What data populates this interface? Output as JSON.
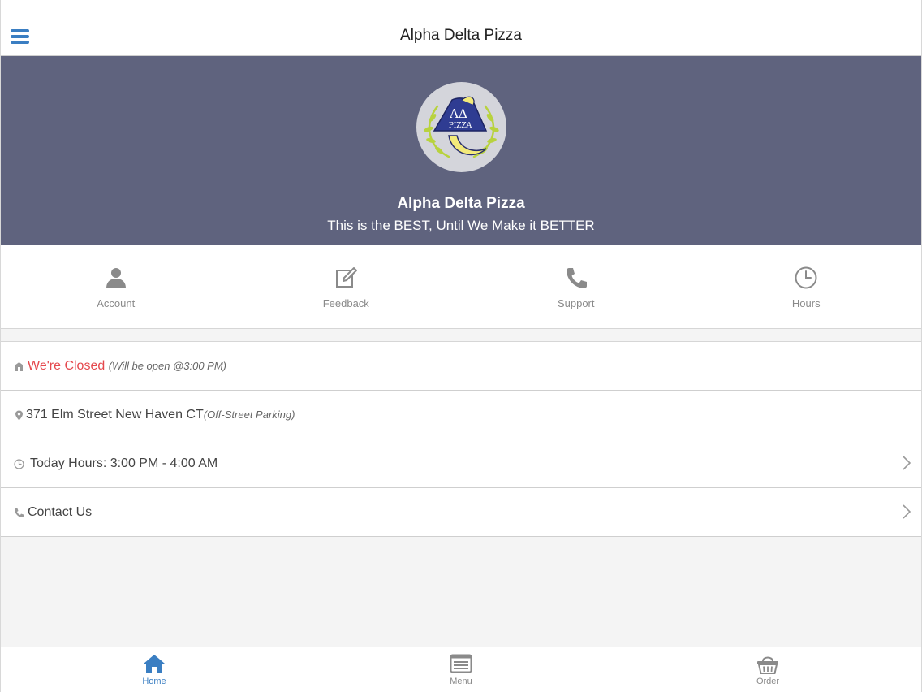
{
  "header": {
    "title": "Alpha Delta Pizza",
    "menu_icon": "hamburger-menu-icon"
  },
  "hero": {
    "name": "Alpha Delta Pizza",
    "tagline": "This is the BEST, Until We Make it BETTER",
    "logo_text_top": "AΔ",
    "logo_text_bottom": "PIZZA"
  },
  "actions": [
    {
      "label": "Account",
      "icon": "user-icon"
    },
    {
      "label": "Feedback",
      "icon": "edit-icon"
    },
    {
      "label": "Support",
      "icon": "phone-icon"
    },
    {
      "label": "Hours",
      "icon": "clock-icon"
    }
  ],
  "info": {
    "status": {
      "label": "We're Closed",
      "note": "(Will be open @3:00 PM)",
      "icon": "store-icon"
    },
    "address": {
      "label": "371 Elm Street New Haven CT",
      "note": "(Off-Street Parking)",
      "icon": "map-pin-icon"
    },
    "hours": {
      "label": "Today Hours: 3:00 PM - 4:00 AM",
      "icon": "clock-icon"
    },
    "contact": {
      "label": "Contact Us",
      "icon": "phone-icon"
    }
  },
  "tabs": [
    {
      "label": "Home",
      "icon": "home-icon",
      "active": true
    },
    {
      "label": "Menu",
      "icon": "menu-list-icon",
      "active": false
    },
    {
      "label": "Order",
      "icon": "basket-icon",
      "active": false
    }
  ],
  "colors": {
    "accent": "#3a7ec2",
    "hero_bg": "#5f637e",
    "closed": "#e5484d",
    "icon_gray": "#8a8a8a"
  }
}
